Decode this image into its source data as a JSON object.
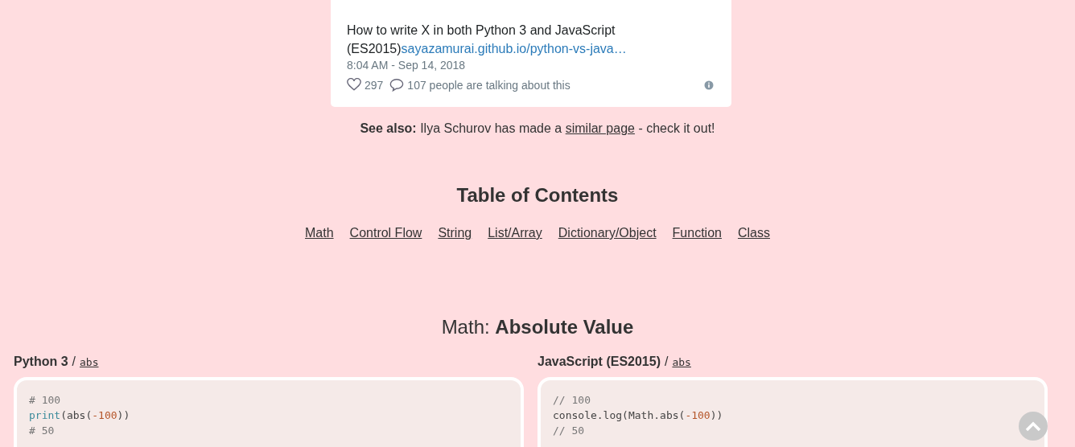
{
  "tweet": {
    "text": "How to write X in both Python 3 and JavaScript (ES2015)",
    "link": "sayazamurai.github.io/python-vs-java…",
    "time": "8:04 AM - Sep 14, 2018",
    "likes": "297",
    "talking": "107 people are talking about this"
  },
  "see_also": {
    "label": "See also:",
    "before": "Ilya Schurov has made a",
    "link": "similar page",
    "after": "- check it out!"
  },
  "toc": {
    "title": "Table of Contents",
    "items": [
      "Math",
      "Control Flow",
      "String",
      "List/Array",
      "Dictionary/Object",
      "Function",
      "Class"
    ]
  },
  "section": {
    "category": "Math:",
    "title": "Absolute Value"
  },
  "panels": [
    {
      "language": "Python 3",
      "separator": "/",
      "doc": "abs",
      "lines": [
        [
          {
            "kind": "comment",
            "text": "# 100"
          }
        ],
        [
          {
            "kind": "builtin",
            "text": "print"
          },
          {
            "kind": "plain",
            "text": "(abs("
          },
          {
            "kind": "number",
            "text": "-100"
          },
          {
            "kind": "plain",
            "text": "))"
          }
        ],
        [
          {
            "kind": "comment",
            "text": "# 50"
          }
        ]
      ]
    },
    {
      "language": "JavaScript (ES2015)",
      "separator": "/",
      "doc": "abs",
      "lines": [
        [
          {
            "kind": "comment",
            "text": "// 100"
          }
        ],
        [
          {
            "kind": "plain",
            "text": "console.log(Math.abs("
          },
          {
            "kind": "number",
            "text": "-100"
          },
          {
            "kind": "plain",
            "text": "))"
          }
        ],
        [
          {
            "kind": "comment",
            "text": "// 50"
          }
        ]
      ]
    }
  ]
}
